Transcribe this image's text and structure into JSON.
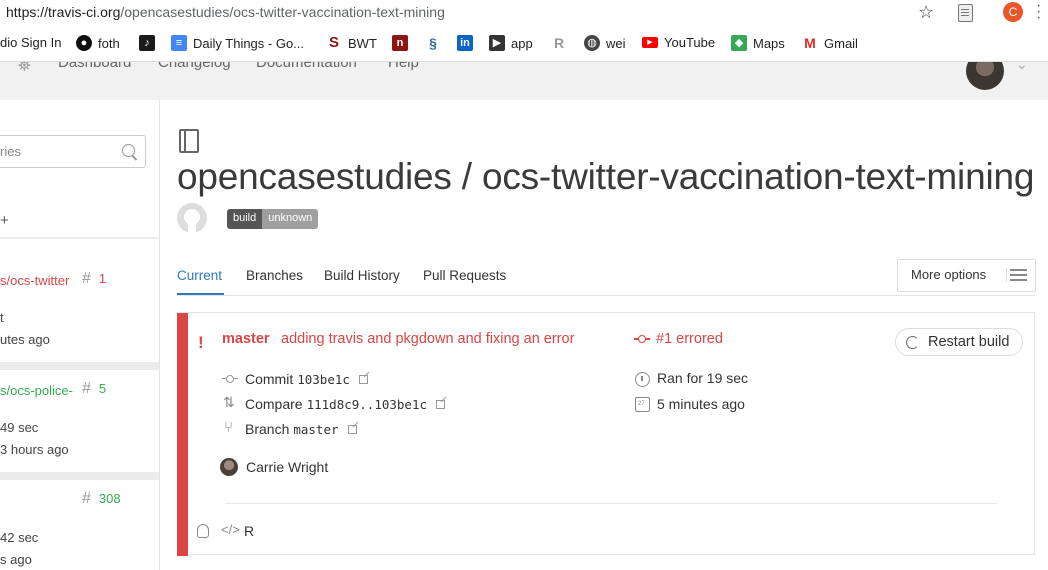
{
  "browser": {
    "url_host": "https://travis-ci.org",
    "url_path": "/opencasestudies/ocs-twitter-vaccination-text-mining",
    "profile_initial": "C"
  },
  "bookmarks": [
    {
      "label": "dio Sign In",
      "icon": "none"
    },
    {
      "label": "foth",
      "icon": "github-icon"
    },
    {
      "label": "",
      "icon": "music-icon",
      "color": "#1a1a1a"
    },
    {
      "label": "Daily Things - Go...",
      "icon": "docs-icon",
      "color": "#4285f4"
    },
    {
      "label": "BWT",
      "icon": "stanford-icon",
      "color": "#8c1515"
    },
    {
      "label": "",
      "icon": "n-icon",
      "color": "#8c1515"
    },
    {
      "label": "",
      "icon": "s-icon",
      "color": "#2a6f9a"
    },
    {
      "label": "",
      "icon": "linkedin-icon",
      "color": "#0a66c2"
    },
    {
      "label": "app",
      "icon": "app-icon",
      "color": "#333"
    },
    {
      "label": "",
      "icon": "r-icon",
      "color": "#999"
    },
    {
      "label": "wei",
      "icon": "globe-icon",
      "color": "#444"
    },
    {
      "label": "YouTube",
      "icon": "youtube-icon",
      "color": "#ff0000"
    },
    {
      "label": "Maps",
      "icon": "maps-icon",
      "color": "#34a853"
    },
    {
      "label": "Gmail",
      "icon": "gmail-icon",
      "color": "#d93025"
    }
  ],
  "nav": {
    "dashboard": "Dashboard",
    "changelog": "Changelog",
    "documentation": "Documentation",
    "help": "Help"
  },
  "sidebar": {
    "search_placeholder": "ries",
    "add": "+",
    "items": [
      {
        "repo": "s/ocs-twitter",
        "num": "1",
        "status": "errored",
        "line1": "t",
        "line2": "utes ago"
      },
      {
        "repo": "s/ocs-police-",
        "num": "5",
        "status": "passed",
        "line1": "49 sec",
        "line2": "3 hours ago"
      },
      {
        "repo": "",
        "num": "308",
        "status": "passed",
        "line1": "42 sec",
        "line2": "s ago"
      }
    ]
  },
  "repo": {
    "title": "opencasestudies / ocs-twitter-vaccination-text-mining",
    "badge_left": "build",
    "badge_right": "unknown"
  },
  "tabs": [
    "Current",
    "Branches",
    "Build History",
    "Pull Requests"
  ],
  "more_options": "More options",
  "build": {
    "branch": "master",
    "message": "adding travis and pkgdown and fixing an error",
    "status": "#1 errored",
    "restart_label": "Restart build",
    "commit_label": "Commit",
    "commit_sha": "103be1c",
    "compare_label": "Compare",
    "compare_range": "111d8c9..103be1c",
    "branch_label": "Branch",
    "branch_value": "master",
    "duration": "Ran for 19 sec",
    "finished": "5 minutes ago",
    "author": "Carrie Wright",
    "language": "R"
  },
  "colors": {
    "error": "#db4545",
    "passed": "#39aa56",
    "link": "#2b7bb9"
  }
}
